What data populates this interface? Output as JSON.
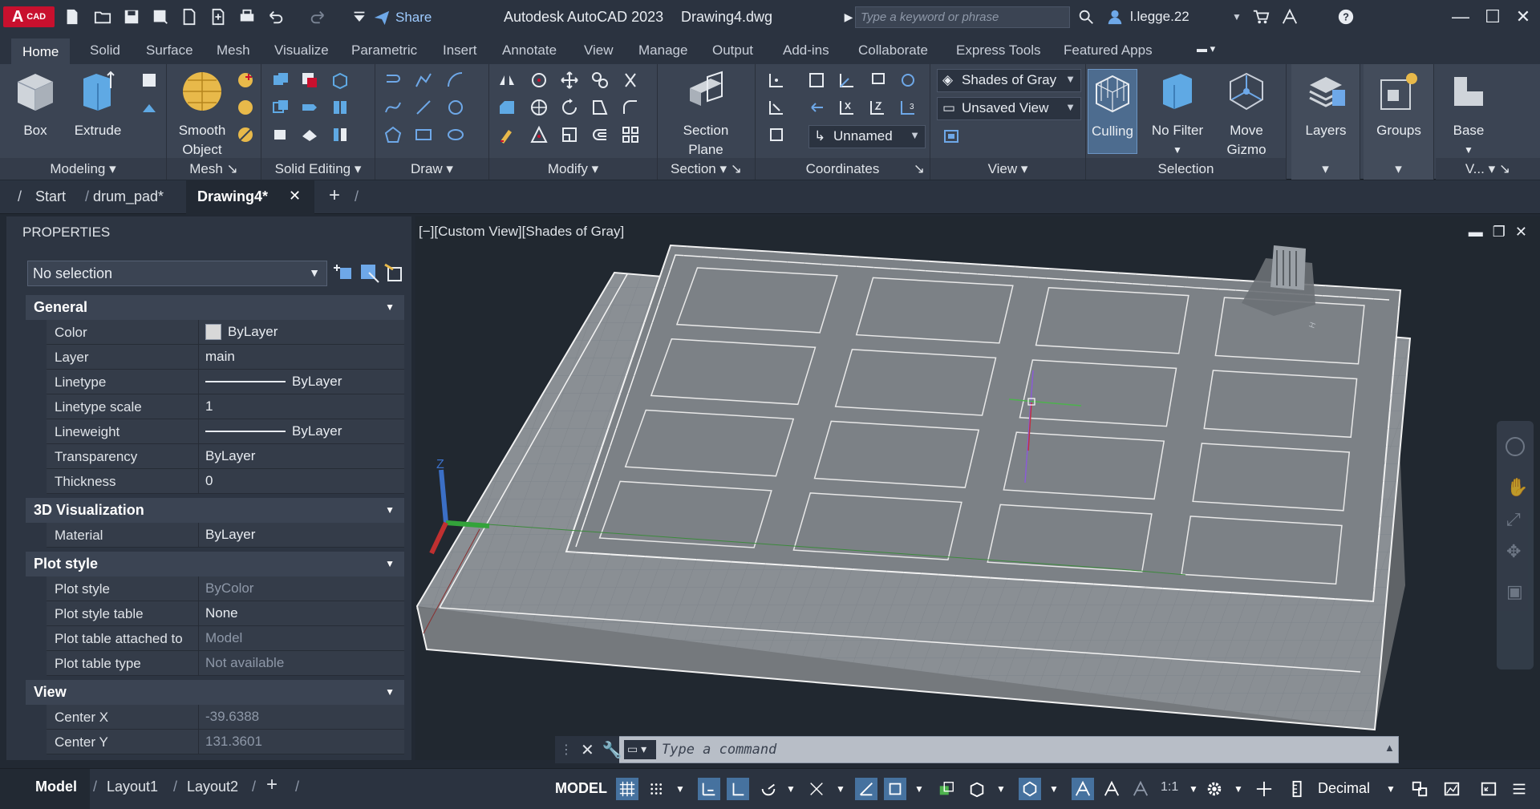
{
  "titlebar": {
    "app": "A",
    "app_sub": "CAD",
    "share": "Share",
    "title": "Autodesk AutoCAD 2023",
    "file": "Drawing4.dwg",
    "search_placeholder": "Type a keyword or phrase",
    "user": "l.legge.22"
  },
  "ribbon_tabs": [
    "Home",
    "Solid",
    "Surface",
    "Mesh",
    "Visualize",
    "Parametric",
    "Insert",
    "Annotate",
    "View",
    "Manage",
    "Output",
    "Add-ins",
    "Collaborate",
    "Express Tools",
    "Featured Apps"
  ],
  "panels": {
    "modeling": "Modeling",
    "mesh": "Mesh",
    "solid_editing": "Solid Editing",
    "draw": "Draw",
    "modify": "Modify",
    "section": "Section",
    "coordinates": "Coordinates",
    "view": "View",
    "selection": "Selection",
    "view_short": "V..."
  },
  "buttons": {
    "box": "Box",
    "extrude": "Extrude",
    "smooth_object_1": "Smooth",
    "smooth_object_2": "Object",
    "section_plane_1": "Section",
    "section_plane_2": "Plane",
    "culling": "Culling",
    "no_filter": "No Filter",
    "move_gizmo_1": "Move",
    "move_gizmo_2": "Gizmo",
    "layers": "Layers",
    "groups": "Groups",
    "base": "Base"
  },
  "dropdowns": {
    "visual_style": "Shades of Gray",
    "saved_view": "Unsaved View",
    "ucs": "Unnamed"
  },
  "doc_tabs": [
    "Start",
    "drum_pad*",
    "Drawing4*"
  ],
  "properties": {
    "title": "PROPERTIES",
    "selection": "No selection",
    "sections": [
      {
        "title": "General",
        "rows": [
          {
            "k": "Color",
            "v": "ByLayer",
            "kind": "swatch"
          },
          {
            "k": "Layer",
            "v": "main"
          },
          {
            "k": "Linetype",
            "v": "ByLayer",
            "kind": "line"
          },
          {
            "k": "Linetype scale",
            "v": "1"
          },
          {
            "k": "Lineweight",
            "v": "ByLayer",
            "kind": "line"
          },
          {
            "k": "Transparency",
            "v": "ByLayer"
          },
          {
            "k": "Thickness",
            "v": "0"
          }
        ]
      },
      {
        "title": "3D Visualization",
        "rows": [
          {
            "k": "Material",
            "v": "ByLayer"
          }
        ]
      },
      {
        "title": "Plot style",
        "rows": [
          {
            "k": "Plot style",
            "v": "ByColor",
            "kind": "dim"
          },
          {
            "k": "Plot style table",
            "v": "None"
          },
          {
            "k": "Plot table attached to",
            "v": "Model",
            "kind": "dim"
          },
          {
            "k": "Plot table type",
            "v": "Not available",
            "kind": "dim"
          }
        ]
      },
      {
        "title": "View",
        "rows": [
          {
            "k": "Center X",
            "v": "-39.6388",
            "kind": "dim"
          },
          {
            "k": "Center Y",
            "v": "131.3601",
            "kind": "dim"
          }
        ]
      }
    ]
  },
  "viewport": {
    "label": "[−][Custom View][Shades of Gray]",
    "axis_z": "Z"
  },
  "command": {
    "placeholder": "Type a command"
  },
  "layout_tabs": [
    "Model",
    "Layout1",
    "Layout2"
  ],
  "status": {
    "model": "MODEL",
    "scale": "1:1",
    "units": "Decimal"
  },
  "colors": {
    "accent": "#46729f",
    "app_red": "#c8102e",
    "background": "#222933"
  }
}
